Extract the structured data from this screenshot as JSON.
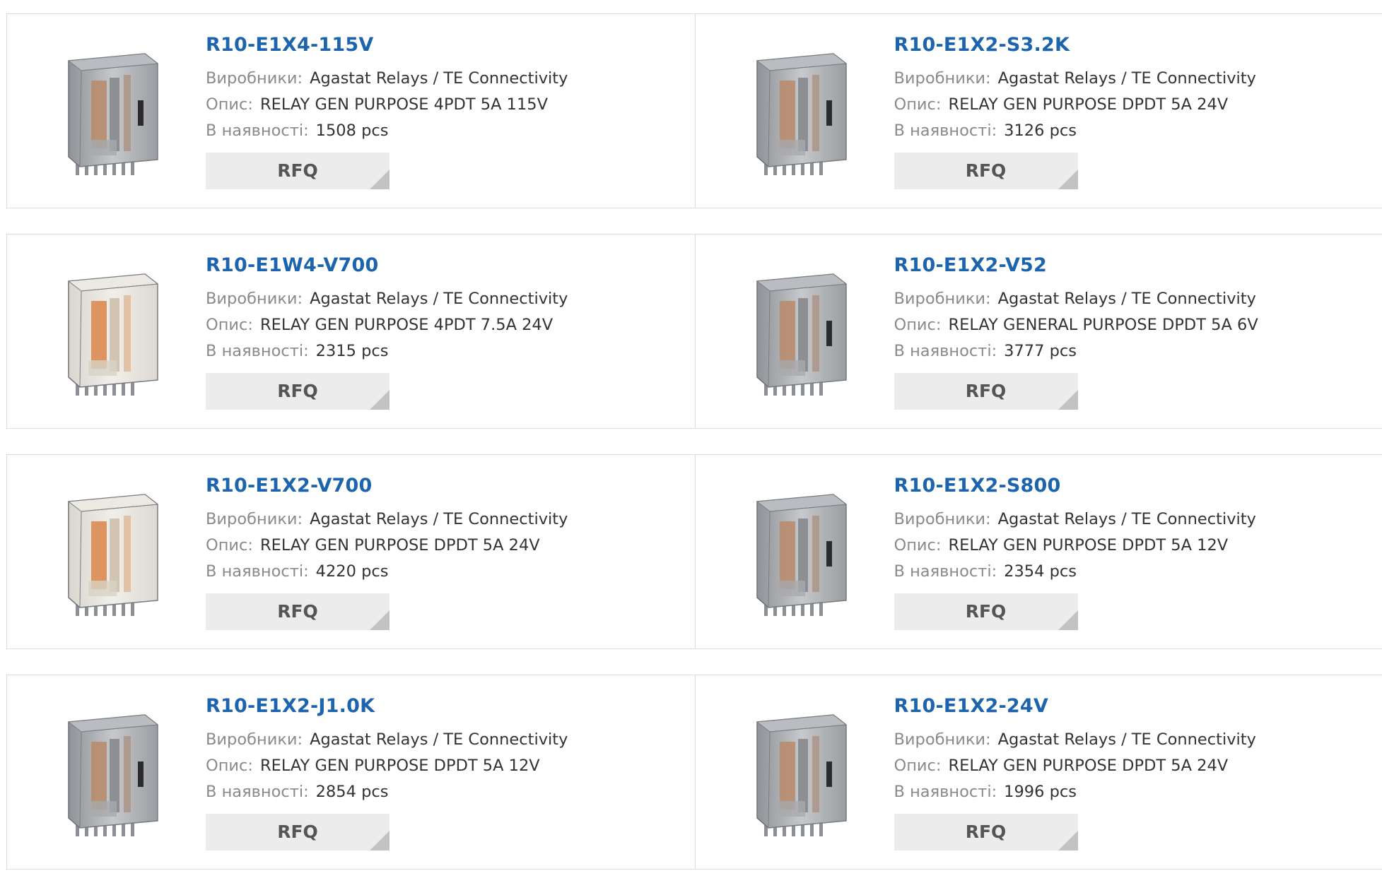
{
  "products": [
    {
      "part_number": "R10-E1X4-115V",
      "manufacturer_label": "Виробники:",
      "manufacturer": "Agastat Relays / TE Connectivity",
      "description_label": "Опис:",
      "description": "RELAY GEN PURPOSE 4PDT 5A 115V",
      "stock_label": "В наявності:",
      "stock": "1508 pcs",
      "rfq_label": "RFQ",
      "image_icon": "relay-grey-icon"
    },
    {
      "part_number": "R10-E1X2-S3.2K",
      "manufacturer_label": "Виробники:",
      "manufacturer": "Agastat Relays / TE Connectivity",
      "description_label": "Опис:",
      "description": "RELAY GEN PURPOSE DPDT 5A 24V",
      "stock_label": "В наявності:",
      "stock": "3126 pcs",
      "rfq_label": "RFQ",
      "image_icon": "relay-grey-icon"
    },
    {
      "part_number": "R10-E1W4-V700",
      "manufacturer_label": "Виробники:",
      "manufacturer": "Agastat Relays / TE Connectivity",
      "description_label": "Опис:",
      "description": "RELAY GEN PURPOSE 4PDT 7.5A 24V",
      "stock_label": "В наявності:",
      "stock": "2315 pcs",
      "rfq_label": "RFQ",
      "image_icon": "relay-clear-icon"
    },
    {
      "part_number": "R10-E1X2-V52",
      "manufacturer_label": "Виробники:",
      "manufacturer": "Agastat Relays / TE Connectivity",
      "description_label": "Опис:",
      "description": "RELAY GENERAL PURPOSE DPDT 5A 6V",
      "stock_label": "В наявності:",
      "stock": "3777 pcs",
      "rfq_label": "RFQ",
      "image_icon": "relay-grey-icon"
    },
    {
      "part_number": "R10-E1X2-V700",
      "manufacturer_label": "Виробники:",
      "manufacturer": "Agastat Relays / TE Connectivity",
      "description_label": "Опис:",
      "description": "RELAY GEN PURPOSE DPDT 5A 24V",
      "stock_label": "В наявності:",
      "stock": "4220 pcs",
      "rfq_label": "RFQ",
      "image_icon": "relay-clear-icon"
    },
    {
      "part_number": "R10-E1X2-S800",
      "manufacturer_label": "Виробники:",
      "manufacturer": "Agastat Relays / TE Connectivity",
      "description_label": "Опис:",
      "description": "RELAY GEN PURPOSE DPDT 5A 12V",
      "stock_label": "В наявності:",
      "stock": "2354 pcs",
      "rfq_label": "RFQ",
      "image_icon": "relay-grey-icon"
    },
    {
      "part_number": "R10-E1X2-J1.0K",
      "manufacturer_label": "Виробники:",
      "manufacturer": "Agastat Relays / TE Connectivity",
      "description_label": "Опис:",
      "description": "RELAY GEN PURPOSE DPDT 5A 12V",
      "stock_label": "В наявності:",
      "stock": "2854 pcs",
      "rfq_label": "RFQ",
      "image_icon": "relay-grey-icon"
    },
    {
      "part_number": "R10-E1X2-24V",
      "manufacturer_label": "Виробники:",
      "manufacturer": "Agastat Relays / TE Connectivity",
      "description_label": "Опис:",
      "description": "RELAY GEN PURPOSE DPDT 5A 24V",
      "stock_label": "В наявності:",
      "stock": "1996 pcs",
      "rfq_label": "RFQ",
      "image_icon": "relay-grey-icon"
    }
  ],
  "colors": {
    "link": "#1d64ae",
    "label": "#8a8a8a",
    "value": "#333333",
    "button_bg": "#ececec",
    "border": "#dcdcdc"
  }
}
